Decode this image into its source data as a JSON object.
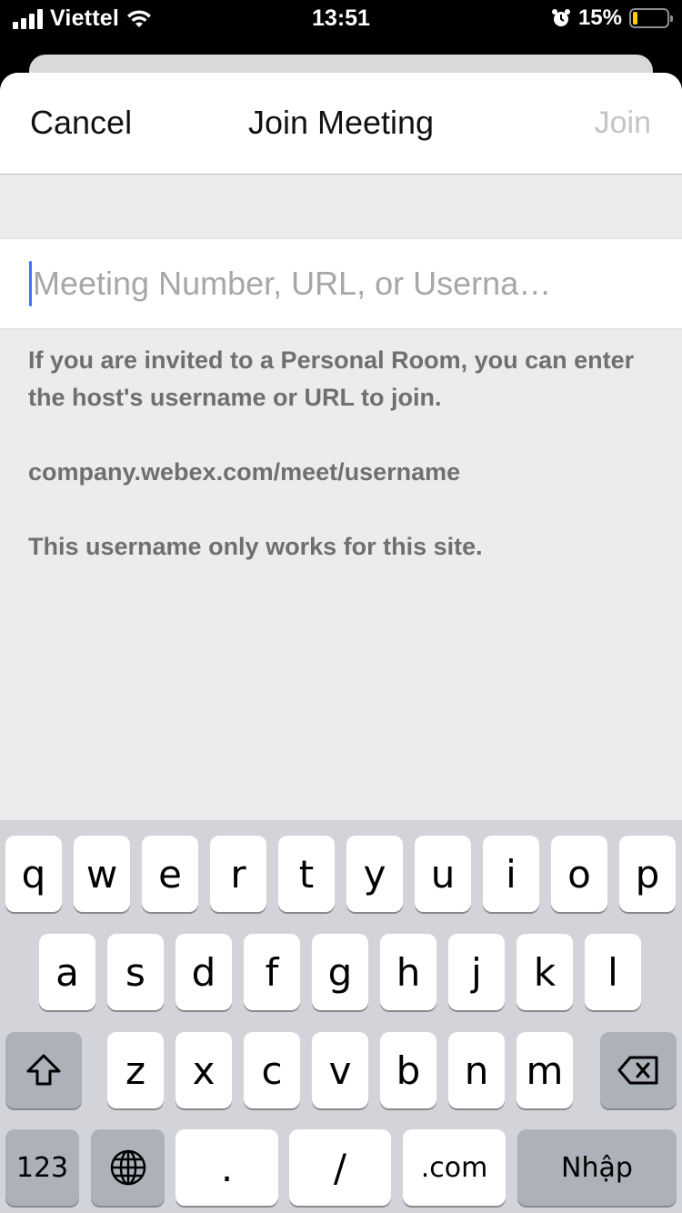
{
  "status_bar": {
    "carrier": "Viettel",
    "time": "13:51",
    "battery_percent": "15%",
    "battery_level": 0.15,
    "battery_color": "#ffcc00"
  },
  "header": {
    "cancel_label": "Cancel",
    "title": "Join Meeting",
    "join_label": "Join"
  },
  "meeting_input": {
    "placeholder": "Meeting Number, URL, or Userna…",
    "value": ""
  },
  "help": {
    "line1": "If you are invited to a Personal Room, you can enter the host's username or URL to join.",
    "line2": "company.webex.com/meet/username",
    "line3": "This username only works for this site."
  },
  "keyboard": {
    "row1": [
      "q",
      "w",
      "e",
      "r",
      "t",
      "y",
      "u",
      "i",
      "o",
      "p"
    ],
    "row2": [
      "a",
      "s",
      "d",
      "f",
      "g",
      "h",
      "j",
      "k",
      "l"
    ],
    "row3": [
      "z",
      "x",
      "c",
      "v",
      "b",
      "n",
      "m"
    ],
    "numbers_label": "123",
    "period_label": ".",
    "slash_label": "/",
    "dotcom_label": ".com",
    "return_label": "Nhập",
    "icons": {
      "shift": "shift-icon",
      "delete": "delete-icon",
      "globe": "globe-icon"
    }
  },
  "colors": {
    "accent": "#3478f6",
    "join_disabled": "#c4c4c4",
    "keyboard_bg": "#d2d4d9"
  }
}
